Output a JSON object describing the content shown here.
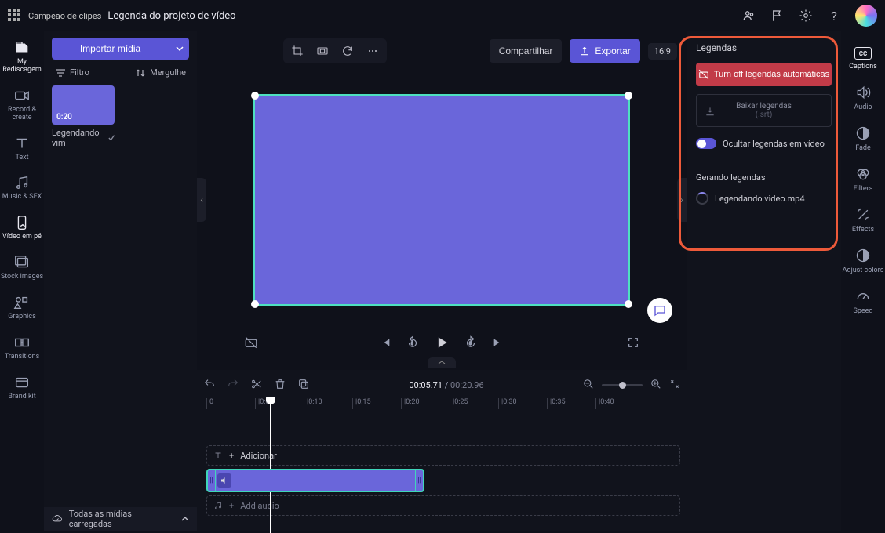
{
  "topbar": {
    "app_name": "Campeão de clipes",
    "project_title": "Legenda do projeto de vídeo"
  },
  "leftnav": [
    {
      "id": "redial",
      "label": "My Rediscagem"
    },
    {
      "id": "record",
      "label": "Record & create"
    },
    {
      "id": "text",
      "label": "Text"
    },
    {
      "id": "music",
      "label": "Music & SFX"
    },
    {
      "id": "standing",
      "label": "Vídeo em pé"
    },
    {
      "id": "stock",
      "label": "Stock images"
    },
    {
      "id": "graphics",
      "label": "Graphics"
    },
    {
      "id": "transitions",
      "label": "Transitions"
    },
    {
      "id": "brand",
      "label": "Brand kit"
    }
  ],
  "mediapanel": {
    "import_label": "Importar mídia",
    "filter_label": "Filtro",
    "dive_label": "Mergulhe",
    "clip_duration": "0:20",
    "clip_name": "Legendando vim",
    "status": "Todas as mídias carregadas"
  },
  "stagebar": {
    "share_label": "Compartilhar",
    "export_label": "Exportar",
    "aspect": "16:9"
  },
  "playback": {
    "current": "00:05.71",
    "duration": "00:20.96"
  },
  "ruler": [
    "0",
    "|0:05",
    "|0:10",
    "|0:15",
    "|0:20",
    "|0:25",
    "|0:30",
    "|0:35",
    "|0:40"
  ],
  "tracks": {
    "add_text_label": "Adicionar",
    "add_audio_label": "Add audio"
  },
  "captions": {
    "title": "Legendas",
    "turn_off_label": "Turn off legendas automáticas",
    "download_main": "Baixar legendas",
    "download_sub": "(.srt)",
    "hide_label": "Ocultar legendas em vídeo",
    "generating_title": "Gerando legendas",
    "generating_file": "Legendando video.mp4"
  },
  "rightnav": [
    {
      "id": "captions",
      "label": "Captions"
    },
    {
      "id": "audio",
      "label": "Audio"
    },
    {
      "id": "fade",
      "label": "Fade"
    },
    {
      "id": "filters",
      "label": "Filters"
    },
    {
      "id": "effects",
      "label": "Effects"
    },
    {
      "id": "adjust",
      "label": "Adjust colors"
    },
    {
      "id": "speed",
      "label": "Speed"
    }
  ]
}
